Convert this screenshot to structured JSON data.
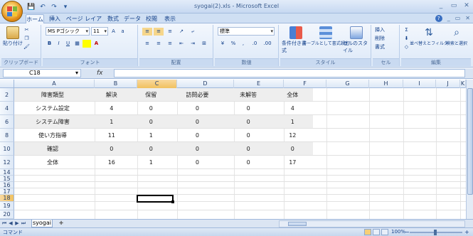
{
  "window": {
    "title": "syogai(2).xls - Microsoft Excel",
    "controls": [
      "_",
      "▭",
      "✕"
    ]
  },
  "qat": {
    "save": "💾",
    "undo": "↶",
    "redo": "↷",
    "customize": "▾"
  },
  "tabs": [
    "ホーム",
    "挿入",
    "ページ レイアウト",
    "数式",
    "データ",
    "校閲",
    "表示"
  ],
  "ribbon": {
    "clipboard": {
      "paste": "貼り付け",
      "label": "クリップボード"
    },
    "font": {
      "name": "MS Pゴシック",
      "size": "11",
      "bold": "B",
      "italic": "I",
      "underline": "U",
      "label": "フォント"
    },
    "alignment": {
      "label": "配置"
    },
    "number": {
      "format": "標準",
      "label": "数値"
    },
    "styles": {
      "conditional": "条件付き書式",
      "table": "テーブルとして書式設定",
      "cell": "セルのスタイル",
      "label": "スタイル"
    },
    "cells": {
      "insert": "挿入",
      "delete": "削除",
      "format": "書式",
      "label": "セル"
    },
    "editing": {
      "sort": "並べ替えとフィルタ",
      "find": "検索と選択",
      "label": "編集"
    }
  },
  "formula_bar": {
    "name_box": "C18",
    "fx": "fx",
    "content": ""
  },
  "columns": [
    "A",
    "B",
    "C",
    "D",
    "E",
    "F",
    "G",
    "H",
    "I",
    "J",
    "K"
  ],
  "selected_column": "C",
  "rows": [
    "2",
    "4",
    "6",
    "8",
    "10",
    "12",
    "14",
    "15",
    "16",
    "17",
    "18",
    "19",
    "20"
  ],
  "selected_row": "18",
  "table": {
    "headers": [
      "障害類型",
      "解決",
      "保留",
      "訪問必要",
      "未解答",
      "全体"
    ],
    "data": [
      [
        "システム設定",
        "4",
        "0",
        "0",
        "0",
        "4"
      ],
      [
        "システム障害",
        "1",
        "0",
        "0",
        "0",
        "1"
      ],
      [
        "使い方指導",
        "11",
        "1",
        "0",
        "0",
        "12"
      ],
      [
        "確認",
        "0",
        "0",
        "0",
        "0",
        "0"
      ],
      [
        "全体",
        "16",
        "1",
        "0",
        "0",
        "17"
      ]
    ]
  },
  "sheet_tabs": [
    "syogai"
  ],
  "status": {
    "mode": "コマンド",
    "zoom": "100%"
  }
}
